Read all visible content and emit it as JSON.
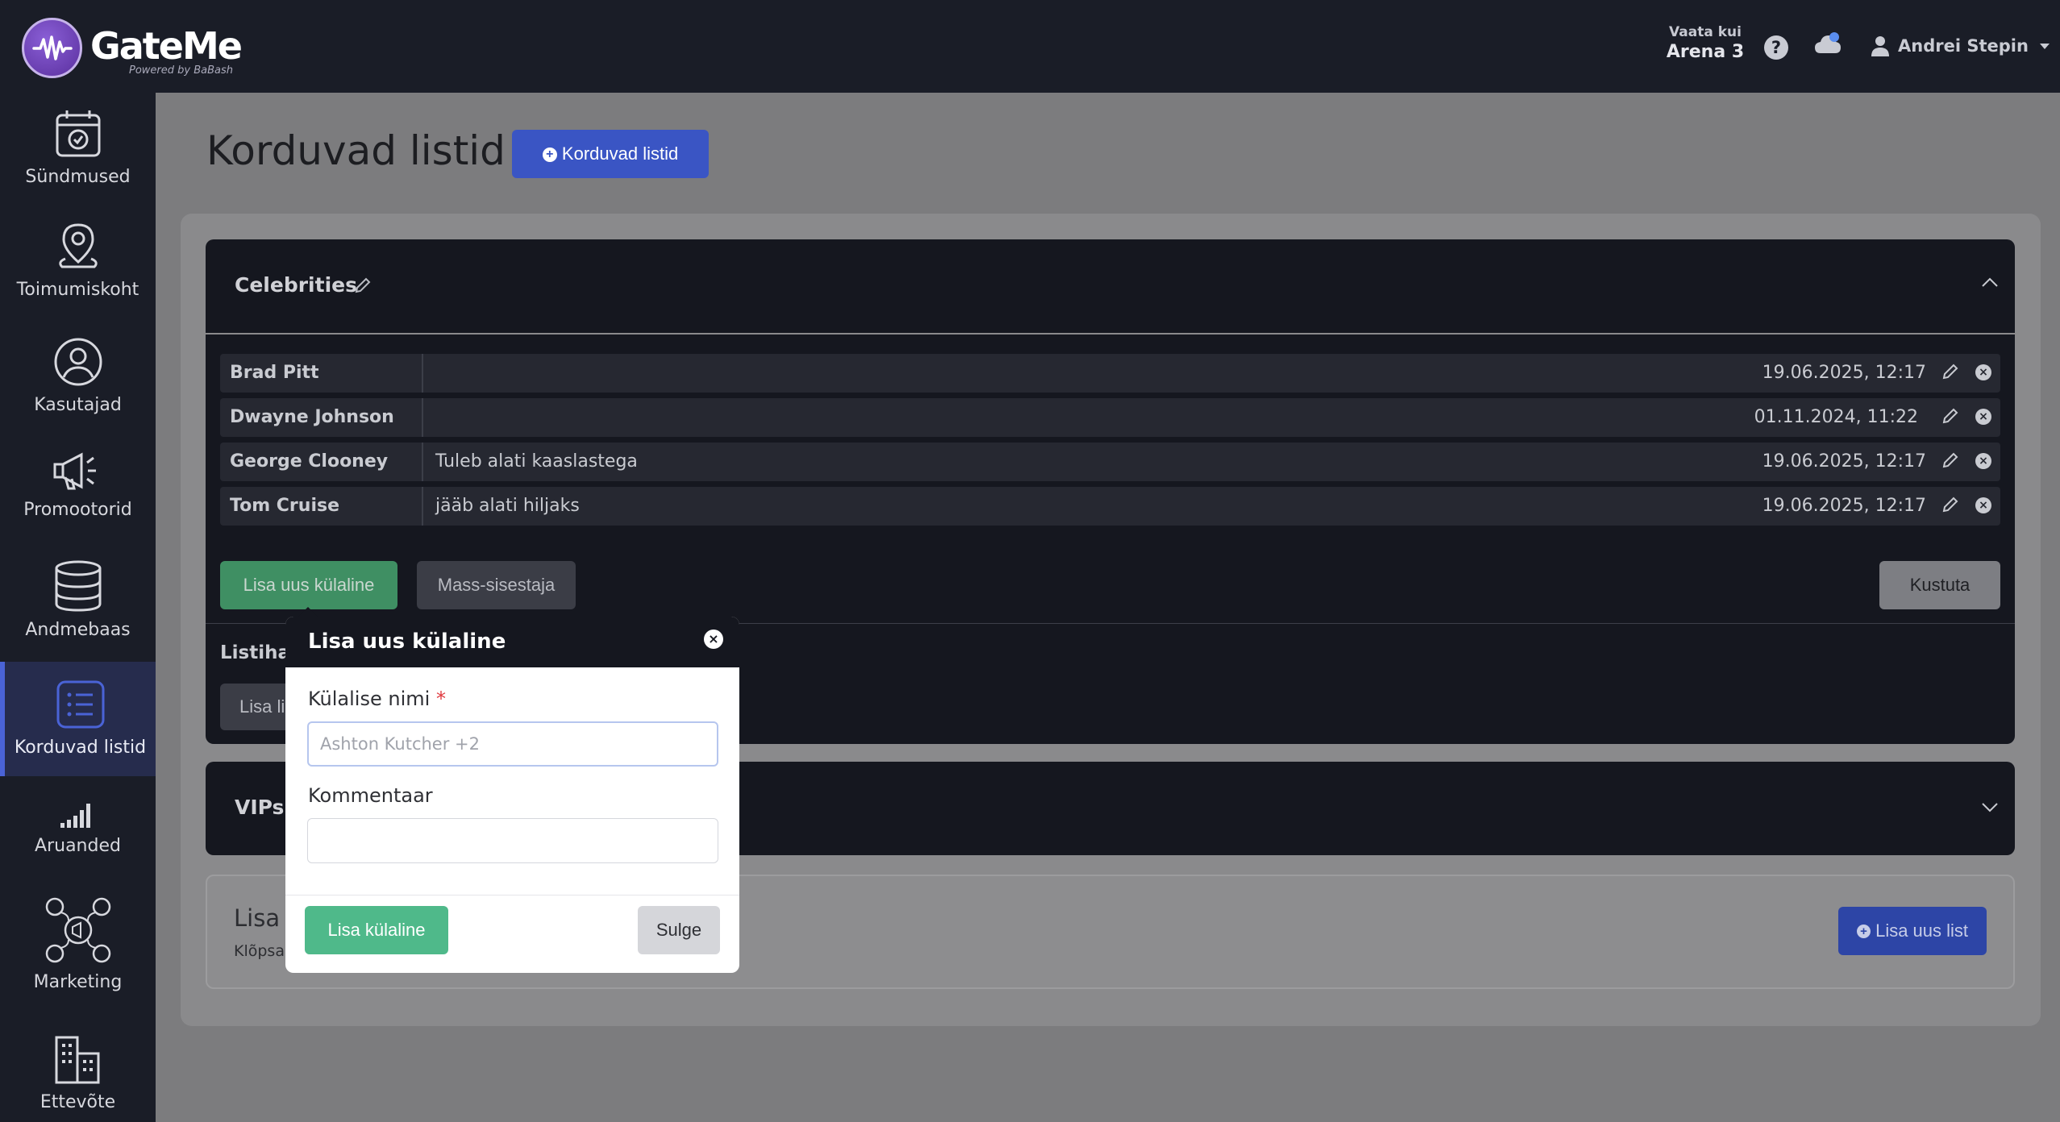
{
  "brand": {
    "name": "GateMe",
    "tagline": "Powered by BaBash"
  },
  "header": {
    "view_as_label": "Vaata kui",
    "view_as_value": "Arena 3",
    "user_name": "Andrei Stepin"
  },
  "sidebar": {
    "items": [
      {
        "label": "Sündmused",
        "icon": "calendar-check-icon"
      },
      {
        "label": "Toimumiskoht",
        "icon": "map-pin-icon"
      },
      {
        "label": "Kasutajad",
        "icon": "user-circle-icon"
      },
      {
        "label": "Promootorid",
        "icon": "megaphone-icon"
      },
      {
        "label": "Andmebaas",
        "icon": "database-icon"
      },
      {
        "label": "Korduvad listid",
        "icon": "list-icon",
        "active": true
      },
      {
        "label": "Aruanded",
        "icon": "signal-bars-icon"
      },
      {
        "label": "Marketing",
        "icon": "social-media-icon"
      },
      {
        "label": "Ettevõte",
        "icon": "buildings-icon"
      }
    ]
  },
  "page": {
    "title": "Korduvad listid",
    "add_button": "Korduvad listid"
  },
  "lists": [
    {
      "title": "Celebrities",
      "guests": [
        {
          "name": "Brad Pitt",
          "comment": "",
          "date": "19.06.2025, 12:17"
        },
        {
          "name": "Dwayne Johnson",
          "comment": "",
          "date": "01.11.2024, 11:22"
        },
        {
          "name": "George Clooney",
          "comment": "Tuleb alati kaaslastega",
          "date": "19.06.2025, 12:17"
        },
        {
          "name": "Tom Cruise",
          "comment": "jääb alati hiljaks",
          "date": "19.06.2025, 12:17"
        }
      ],
      "add_guest_button": "Lisa uus külaline",
      "bulk_import_button": "Mass-sisestaja",
      "delete_button": "Kustuta",
      "section_label_partial": "Listihal",
      "section_button_partial": "Lisa lis"
    },
    {
      "title": "VIPs"
    }
  ],
  "new_list": {
    "title_partial": "Lisa u",
    "hint_partial": "Klõpsa",
    "button": "Lisa uus list"
  },
  "modal": {
    "title": "Lisa uus külaline",
    "name_label": "Külalise nimi",
    "required_mark": "*",
    "name_placeholder": "Ashton Kutcher +2",
    "comment_label": "Kommentaar",
    "submit_button": "Lisa külaline",
    "close_button": "Sulge"
  },
  "colors": {
    "primary": "#3a55c4",
    "success": "#4fb98a",
    "dark": "#15171f"
  }
}
